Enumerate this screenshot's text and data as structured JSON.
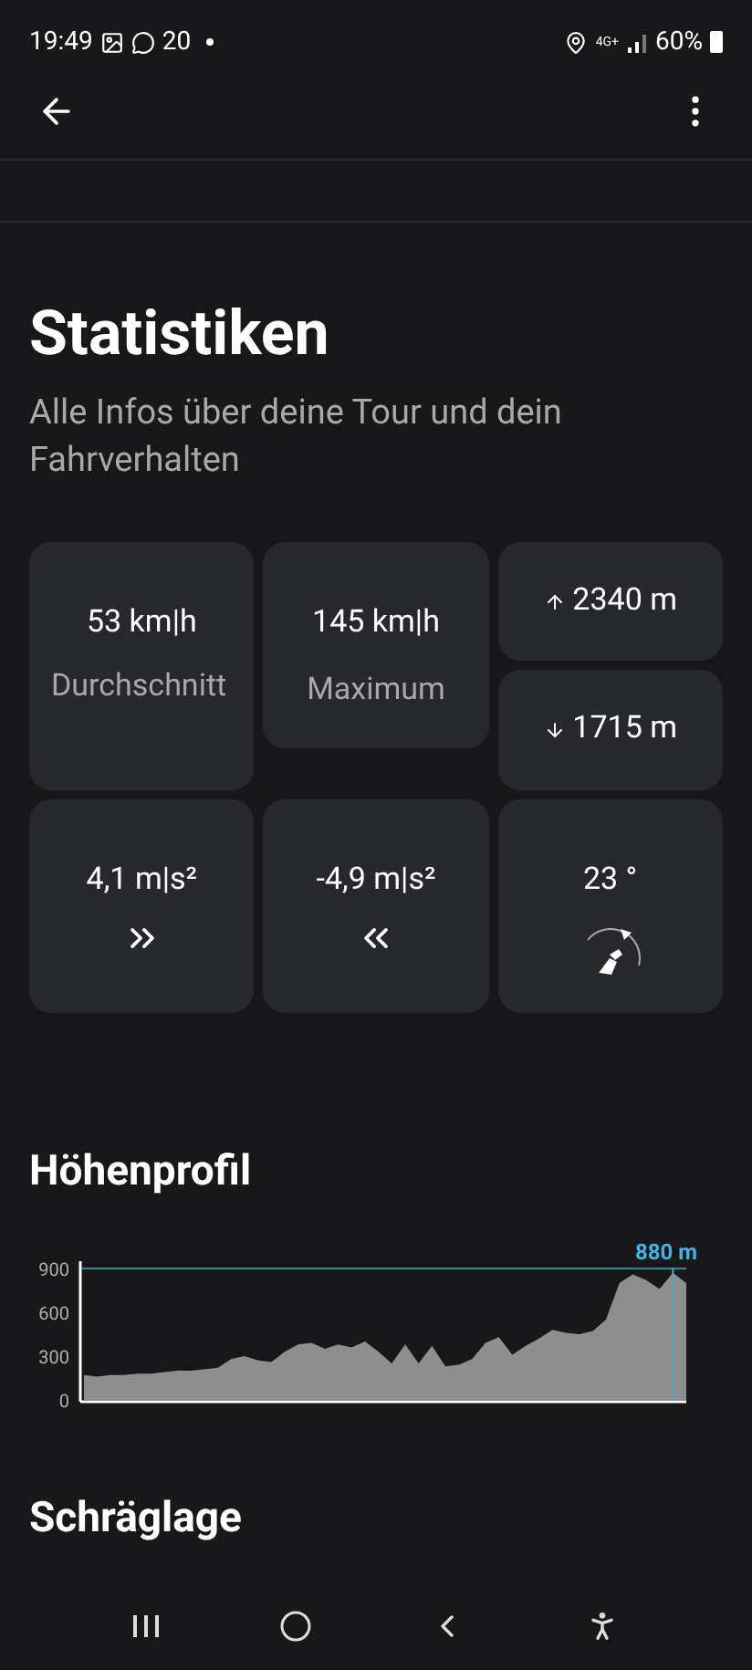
{
  "status_bar": {
    "time": "19:49",
    "notification_count": "20",
    "network": "4G+",
    "battery": "60%"
  },
  "header": {
    "title": "Statistiken",
    "subtitle": "Alle Infos über deine Tour und dein Fahrverhalten"
  },
  "stats": {
    "average": {
      "value": "53 km|h",
      "label": "Durchschnitt"
    },
    "maximum": {
      "value": "145 km|h",
      "label": "Maximum"
    },
    "elevation": [
      {
        "kind": "ascent",
        "value": "2340 m"
      },
      {
        "kind": "descent",
        "value": "1715 m"
      }
    ],
    "bottom": [
      {
        "kind": "acceleration",
        "value": "4,1 m|s²"
      },
      {
        "kind": "braking",
        "value": "-4,9 m|s²"
      },
      {
        "kind": "lean",
        "value": "23 °"
      }
    ]
  },
  "elevation_profile": {
    "title": "Höhenprofil",
    "chart_data": {
      "type": "area",
      "ylim": [
        0,
        900
      ],
      "yticks": [
        0,
        300,
        600,
        900
      ],
      "annotations": [
        "880 m"
      ],
      "values": [
        170,
        160,
        170,
        170,
        180,
        180,
        190,
        200,
        200,
        210,
        220,
        280,
        300,
        270,
        260,
        330,
        380,
        390,
        350,
        380,
        360,
        400,
        330,
        250,
        380,
        250,
        370,
        230,
        240,
        280,
        390,
        430,
        310,
        370,
        420,
        480,
        460,
        450,
        470,
        550,
        800,
        860,
        820,
        760,
        870,
        800
      ]
    }
  },
  "lean_section": {
    "title": "Schräglage"
  }
}
